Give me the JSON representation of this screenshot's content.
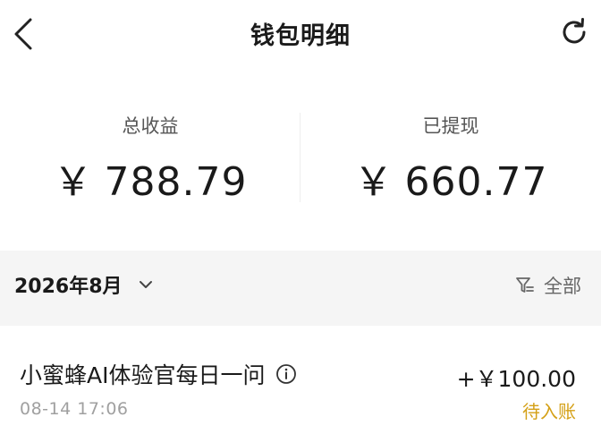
{
  "header": {
    "title": "钱包明细",
    "back_icon": "chevron-left-icon",
    "refresh_icon": "refresh-icon"
  },
  "summary": {
    "total_income": {
      "label": "总收益",
      "currency": "￥",
      "amount": "788.79"
    },
    "withdrawn": {
      "label": "已提现",
      "currency": "￥",
      "amount": "660.77"
    }
  },
  "filter_bar": {
    "month": "2026年8月",
    "month_icon": "chevron-down-icon",
    "filter_icon": "filter-icon",
    "filter_label": "全部"
  },
  "records": [
    {
      "title": "小蜜蜂AI体验官每日一问",
      "info_icon": "info-icon",
      "time": "08-14 17:06",
      "amount": "+￥100.00",
      "status": "待入账",
      "status_color": "#d4a017"
    }
  ]
}
